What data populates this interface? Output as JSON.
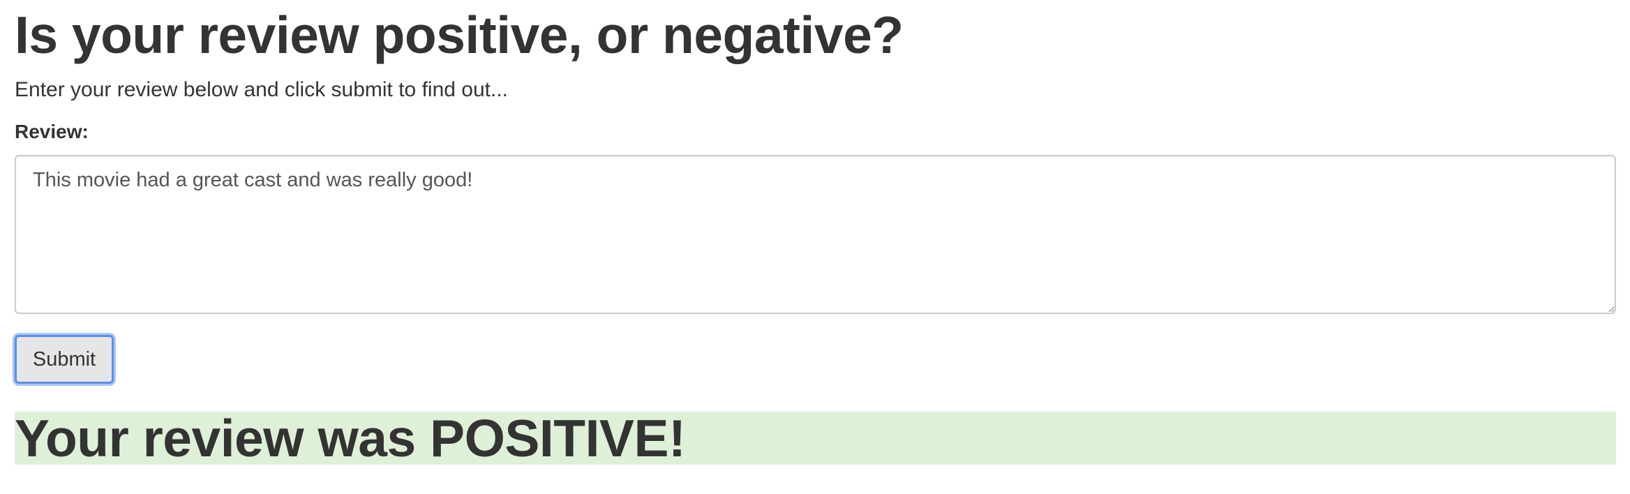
{
  "page": {
    "title": "Is your review positive, or negative?",
    "intro": "Enter your review below and click submit to find out..."
  },
  "form": {
    "review_label": "Review:",
    "review_value": "This movie had a great cast and was really good!",
    "submit_label": "Submit"
  },
  "result": {
    "text": "Your review was POSITIVE!",
    "banner_color": "#dff0d8"
  },
  "colors": {
    "text": "#333333",
    "focus_ring": "#5b8fe8",
    "button_bg": "#e6e6e6"
  }
}
